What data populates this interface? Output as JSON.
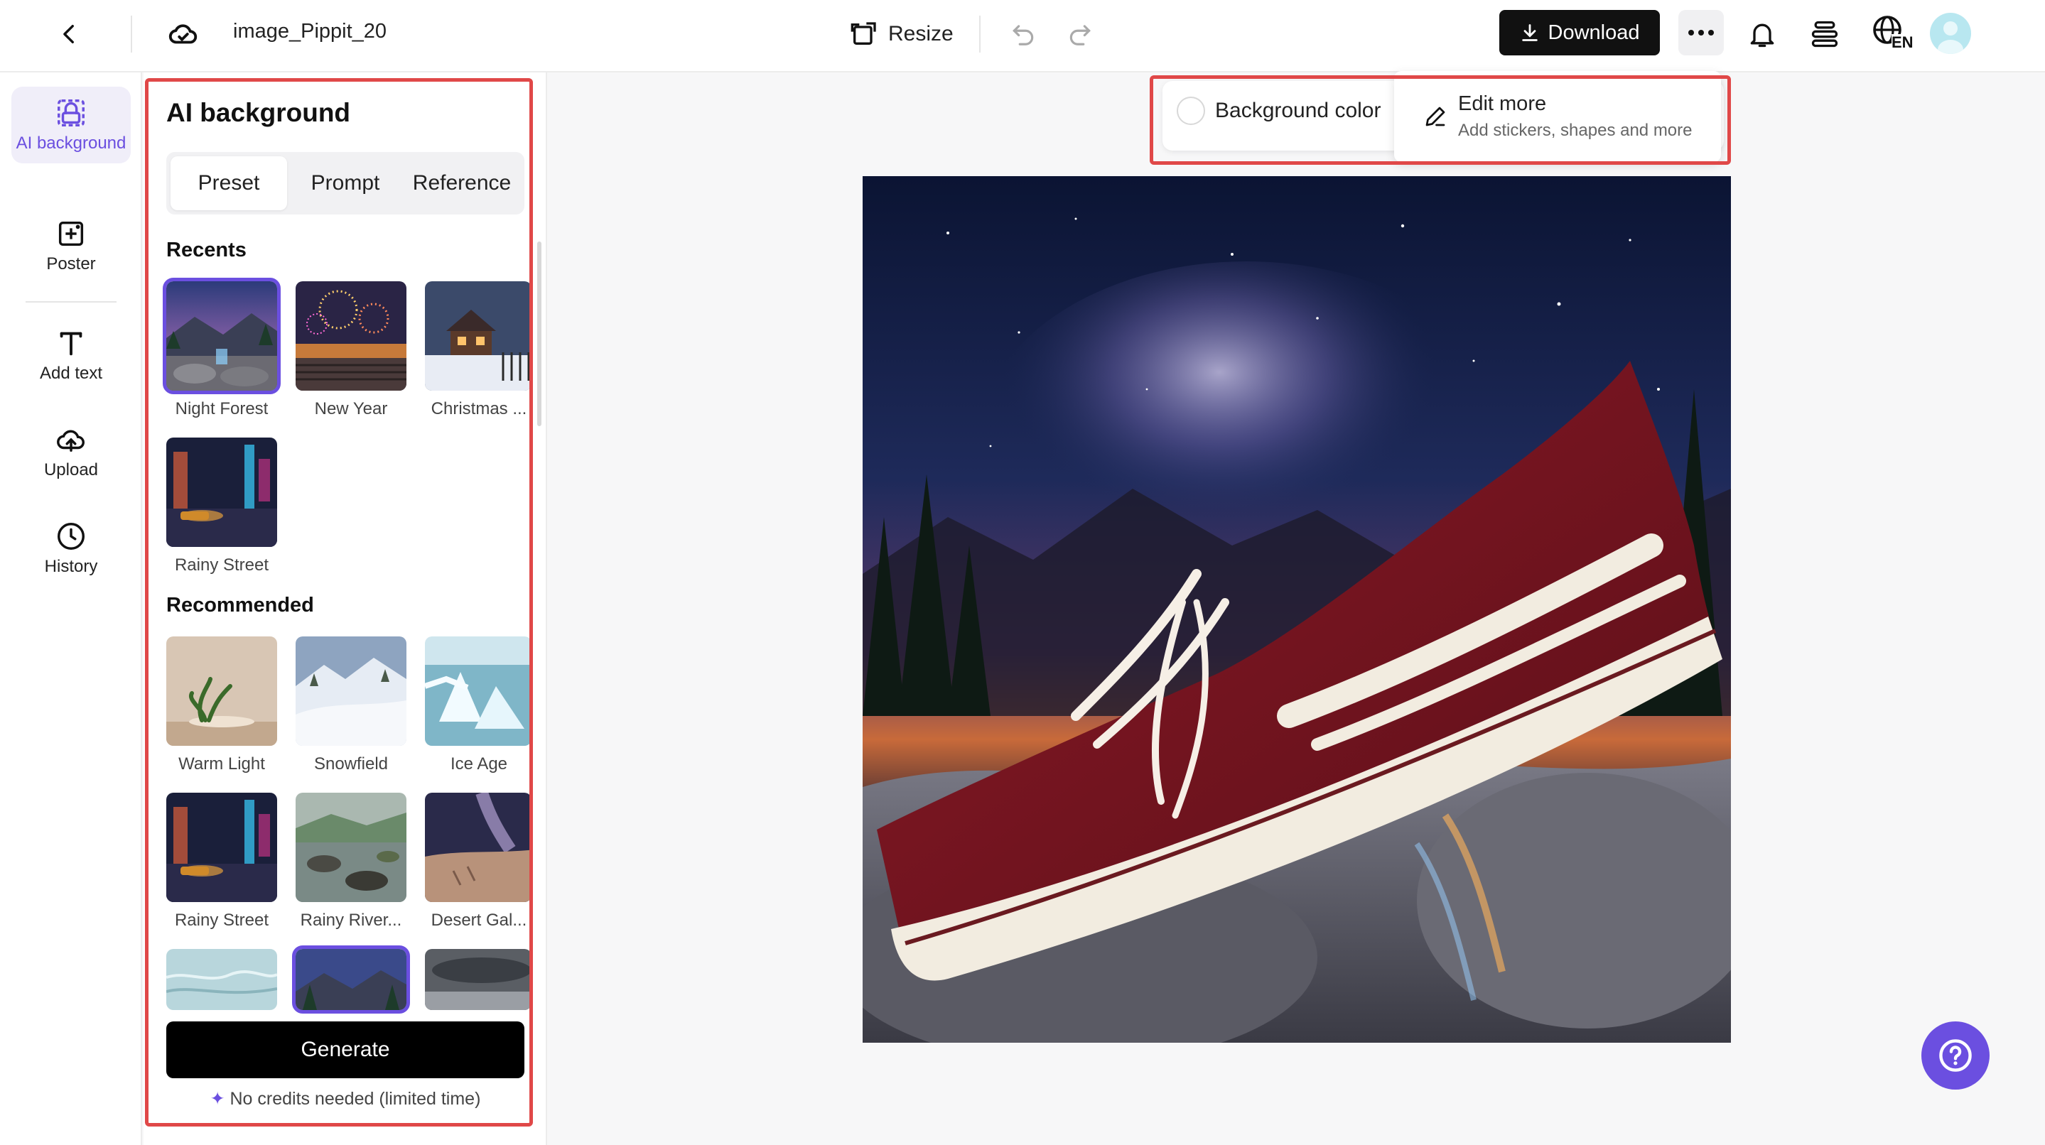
{
  "topbar": {
    "filename": "image_Pippit_20",
    "resize_label": "Resize",
    "download_label": "Download",
    "language_code": "EN"
  },
  "rail": {
    "items": [
      {
        "label": "AI background",
        "icon": "ai-background-icon",
        "active": true
      },
      {
        "label": "Poster",
        "icon": "poster-icon"
      },
      {
        "label": "Add text",
        "icon": "text-icon"
      },
      {
        "label": "Upload",
        "icon": "upload-icon"
      },
      {
        "label": "History",
        "icon": "history-icon"
      }
    ]
  },
  "panel": {
    "title": "AI background",
    "tabs": [
      "Preset",
      "Prompt",
      "Reference"
    ],
    "active_tab": "Preset",
    "recents_heading": "Recents",
    "recents": [
      {
        "label": "Night Forest",
        "selected": true
      },
      {
        "label": "New Year"
      },
      {
        "label": "Christmas ..."
      },
      {
        "label": "Rainy Street"
      }
    ],
    "recommended_heading": "Recommended",
    "recommended": [
      {
        "label": "Warm Light"
      },
      {
        "label": "Snowfield"
      },
      {
        "label": "Ice Age"
      },
      {
        "label": "Rainy Street"
      },
      {
        "label": "Rainy River..."
      },
      {
        "label": "Desert Gal..."
      }
    ],
    "generate_label": "Generate",
    "credit_note": "No credits needed (limited time)"
  },
  "canvas": {
    "background_color_label": "Background color",
    "edit_more_title": "Edit more",
    "edit_more_subtitle": "Add stickers, shapes and more"
  },
  "colors": {
    "accent": "#6b4fe0",
    "highlight": "#e04848",
    "shoe": "#7a1420"
  }
}
